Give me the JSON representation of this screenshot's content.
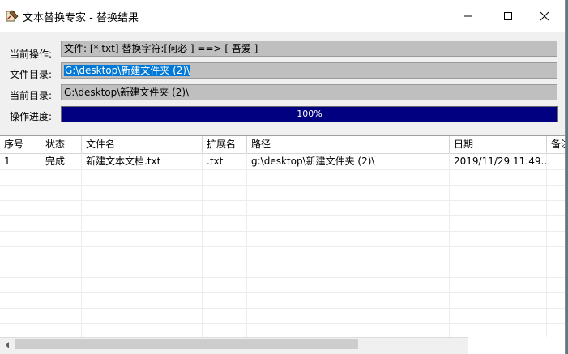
{
  "window": {
    "title": "文本替换专家 - 替换结果"
  },
  "form": {
    "operation_label": "当前操作:",
    "operation_value": "文件: [*.txt]   替换字符:[何必 ] ==> [ 吾爱 ]",
    "file_dir_label": "文件目录:",
    "file_dir_value": "G:\\desktop\\新建文件夹 (2)\\",
    "current_dir_label": "当前目录:",
    "current_dir_value": "G:\\desktop\\新建文件夹 (2)\\",
    "progress_label": "操作进度:",
    "progress_text": "100%",
    "progress_fraction": 1.0
  },
  "table": {
    "columns": [
      "序号",
      "状态",
      "文件名",
      "扩展名",
      "路径",
      "日期",
      "备注"
    ],
    "rows": [
      {
        "index": "1",
        "status": "完成",
        "filename": "新建文本文档.txt",
        "ext": ".txt",
        "path": "g:\\desktop\\新建文件夹 (2)\\",
        "date": "2019/11/29 11:49..."
      }
    ]
  },
  "colors": {
    "progress_fill": "#000080",
    "selection": "#0078d7",
    "field_bg": "#bfbfbf"
  },
  "icons": {
    "app": "app-icon",
    "minimize": "minimize-icon",
    "maximize": "maximize-icon",
    "close": "close-icon",
    "scroll_left": "chevron-left-icon",
    "scroll_right": "chevron-right-icon"
  }
}
